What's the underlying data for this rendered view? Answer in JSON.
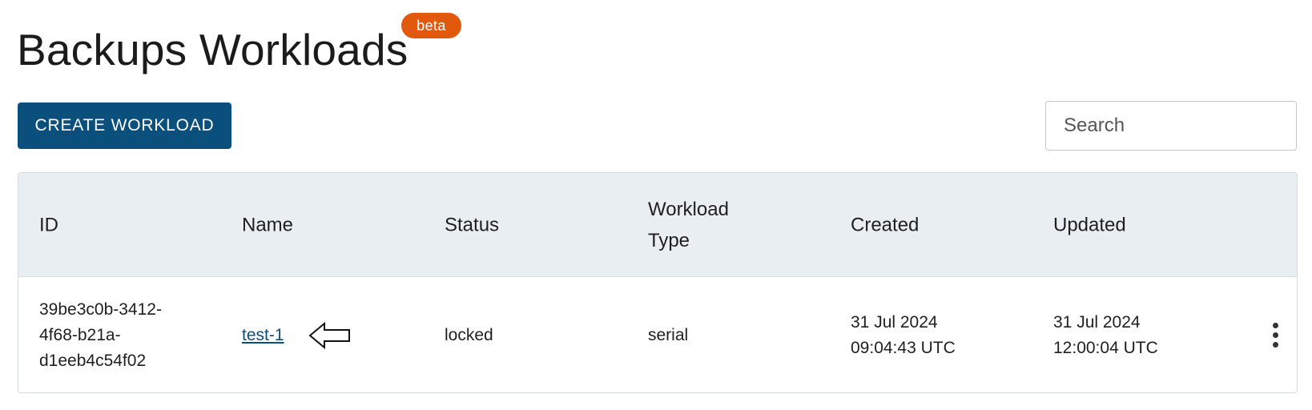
{
  "header": {
    "title": "Backups Workloads",
    "badge": "beta"
  },
  "toolbar": {
    "create_label": "CREATE WORKLOAD",
    "search_placeholder": "Search"
  },
  "table": {
    "columns": [
      "ID",
      "Name",
      "Status",
      "Workload\nType",
      "Created",
      "Updated"
    ],
    "rows": [
      {
        "id": "39be3c0b-3412-\n4f68-b21a-\nd1eeb4c54f02",
        "name": "test-1",
        "status": "locked",
        "workload_type": "serial",
        "created_date": "31 Jul 2024",
        "created_time": "09:04:43 UTC",
        "updated_date": "31 Jul 2024",
        "updated_time": "12:00:04 UTC"
      }
    ]
  },
  "icons": {
    "arrow": "arrow-left-outline-icon",
    "more": "more-vertical-icon"
  },
  "colors": {
    "primary": "#0b4f7c",
    "badge": "#e2580d",
    "header_bg": "#e9eef2"
  }
}
